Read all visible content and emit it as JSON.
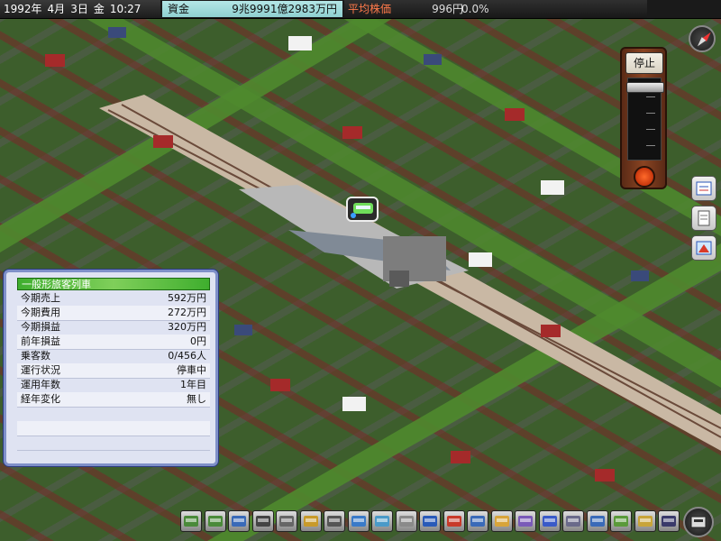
{
  "status_bar": {
    "year": "1992年",
    "month": "4月",
    "day": "3日",
    "weekday": "金",
    "time": "10:27",
    "funds_label": "資金",
    "funds_value": "9兆9991億2983万円",
    "stock_label": "平均株価",
    "stock_value": "996円",
    "stock_change": "0.0%"
  },
  "speed_control": {
    "label": "停止",
    "level": 0
  },
  "info_panel": {
    "title": "一般形旅客列車",
    "rows": [
      {
        "key": "今期売上",
        "value": "592万円"
      },
      {
        "key": "今期費用",
        "value": "272万円"
      },
      {
        "key": "今期損益",
        "value": "320万円"
      },
      {
        "key": "前年損益",
        "value": "0円"
      },
      {
        "key": "乗客数",
        "value": "0/456人"
      },
      {
        "key": "運行状況",
        "value": "停車中"
      },
      {
        "key": "運用年数",
        "value": "1年目"
      },
      {
        "key": "経年変化",
        "value": "無し"
      }
    ]
  },
  "side_icons": [
    "report-icon",
    "document-icon",
    "map-icon"
  ],
  "toolbar_icons": [
    "rail-icon",
    "station-icon",
    "train-icon",
    "road-icon",
    "bus-stop-icon",
    "bus-icon",
    "rail-track-icon",
    "bridge-icon",
    "truck-icon",
    "materials-icon",
    "building-icon",
    "transfer-icon",
    "skyscraper-icon",
    "subsidiary-icon",
    "staff-icon",
    "graph-icon",
    "calendar-icon",
    "settings-icon",
    "terrain-icon",
    "demolish-icon",
    "advisor-icon"
  ],
  "colors": {
    "panel_title": "#3fae2e",
    "funds_bg": "#a6dcdc",
    "stock_label": "#ff7a4a",
    "panel_border": "#7f90c8"
  }
}
